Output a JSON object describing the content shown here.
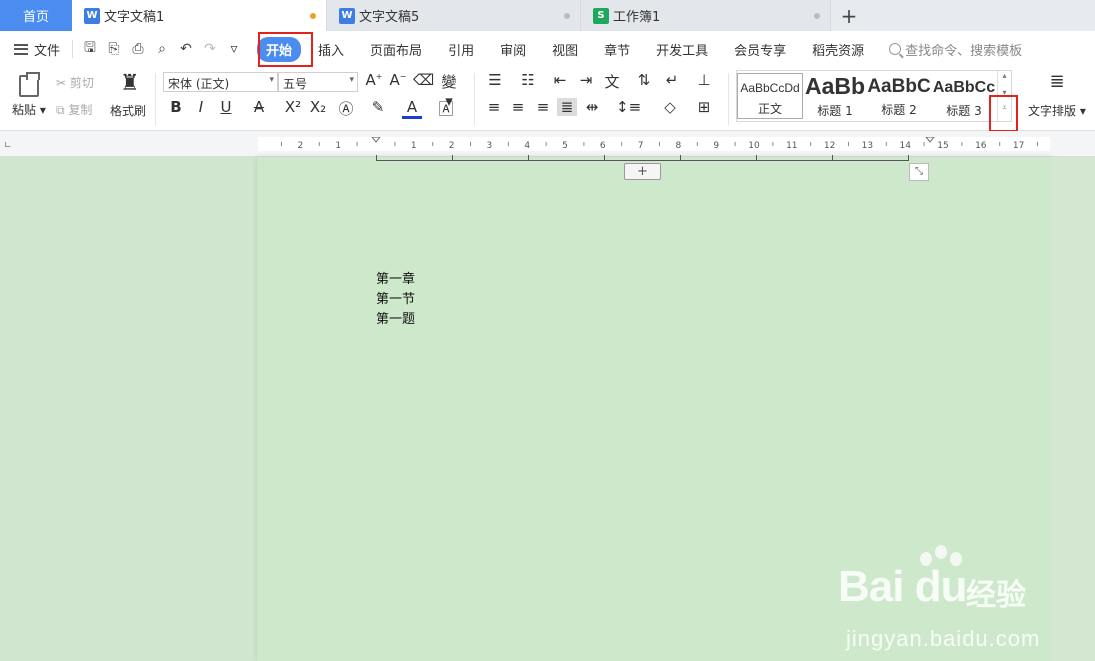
{
  "tabs": {
    "home": "首页",
    "doc1": "文字文稿1",
    "doc2": "文字文稿5",
    "sheet": "工作簿1",
    "w_icon": "W",
    "s_icon": "S",
    "add": "+"
  },
  "menu": {
    "file": "文件",
    "items": [
      "开始",
      "插入",
      "页面布局",
      "引用",
      "审阅",
      "视图",
      "章节",
      "开发工具",
      "会员专享",
      "稻壳资源"
    ],
    "search_placeholder": "查找命令、搜索模板"
  },
  "ribbon": {
    "paste": "粘贴",
    "cut": "剪切",
    "copy": "复制",
    "format_painter": "格式刷",
    "font_name": "宋体 (正文)",
    "font_size": "五号",
    "styles": [
      {
        "sample": "AaBbCcDd",
        "name": "正文"
      },
      {
        "sample": "AaBb",
        "name": "标题 1"
      },
      {
        "sample": "AaBbC",
        "name": "标题 2"
      },
      {
        "sample": "AaBbCc",
        "name": "标题 3"
      }
    ],
    "text_layout": "文字排版"
  },
  "ruler": {
    "numbers": [
      "2",
      "1",
      "",
      "1",
      "2",
      "3",
      "4",
      "5",
      "6",
      "7",
      "8",
      "9",
      "10",
      "11",
      "12",
      "13",
      "14",
      "15",
      "16",
      "17"
    ]
  },
  "document": {
    "lines": [
      "第一章",
      "第一节",
      "第一题"
    ]
  },
  "watermark": {
    "logo": "Bai du",
    "cn": "经验",
    "url": "jingyan.baidu.com"
  },
  "colors": {
    "accent": "#4a8cf0",
    "highlight_box": "#e3211d",
    "page_bg": "#cde8cb"
  }
}
